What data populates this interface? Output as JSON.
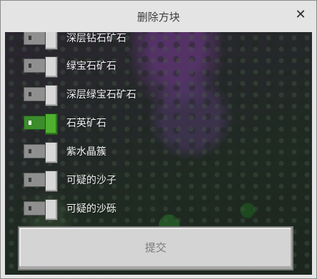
{
  "dialog": {
    "title": "删除方块",
    "close_glyph": "✕"
  },
  "blocks": [
    {
      "label": "深层钻石矿石",
      "enabled": false
    },
    {
      "label": "绿宝石矿石",
      "enabled": false
    },
    {
      "label": "深层绿宝石矿石",
      "enabled": false
    },
    {
      "label": "石英矿石",
      "enabled": true
    },
    {
      "label": "紫水晶簇",
      "enabled": false
    },
    {
      "label": "可疑的沙子",
      "enabled": false
    },
    {
      "label": "可疑的沙砾",
      "enabled": false
    }
  ],
  "submit": {
    "label": "提交"
  },
  "colors": {
    "toggle_on": "#4fb02f",
    "toggle_off": "#d8d8d8",
    "dialog_bg": "#e4e4e4"
  }
}
